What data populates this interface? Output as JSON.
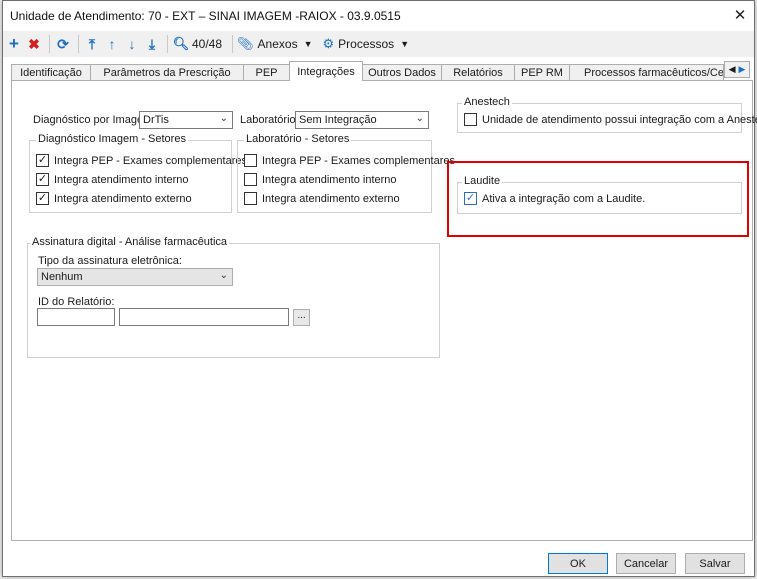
{
  "window": {
    "title": "Unidade de Atendimento: 70 - EXT – SINAI IMAGEM -RAIOX - 03.9.0515"
  },
  "toolbar": {
    "record_position": "40/48",
    "anexos_label": "Anexos",
    "processos_label": "Processos"
  },
  "tabs": [
    {
      "label": "Identificação"
    },
    {
      "label": "Parâmetros da Prescrição"
    },
    {
      "label": "PEP"
    },
    {
      "label": "Integrações"
    },
    {
      "label": "Outros Dados"
    },
    {
      "label": "Relatórios"
    },
    {
      "label": "PEP RM"
    },
    {
      "label": "Processos farmacêuticos/Ce"
    }
  ],
  "diag": {
    "imagem_label": "Diagnóstico por Imagem:",
    "imagem_value": "DrTis",
    "laboratorio_label": "Laboratório:",
    "laboratorio_value": "Sem Integração",
    "setor_imagem_title": "Diagnóstico Imagem - Setores",
    "setor_lab_title": "Laboratório - Setores",
    "opt_pep": "Integra PEP - Exames complementares",
    "opt_interno": "Integra atendimento interno",
    "opt_externo": "Integra atendimento externo"
  },
  "anestech": {
    "title": "Anestech",
    "checkbox_label": "Unidade de atendimento possui integração com a Anestech"
  },
  "laudite": {
    "title": "Laudite",
    "checkbox_label": "Ativa a integração com a Laudite."
  },
  "assinatura": {
    "title": "Assinatura digital - Análise farmacêutica",
    "tipo_label": "Tipo da assinatura eletrônica:",
    "tipo_value": "Nenhum",
    "relatorio_label": "ID do Relatório:",
    "browse_label": "..."
  },
  "buttons": {
    "ok": "OK",
    "cancel": "Cancelar",
    "save": "Salvar"
  },
  "colors": {
    "highlight": "#e10000",
    "accent": "#2b6cc4",
    "delete_red": "#d42020",
    "toolbar_blue": "#1f6fbf"
  }
}
